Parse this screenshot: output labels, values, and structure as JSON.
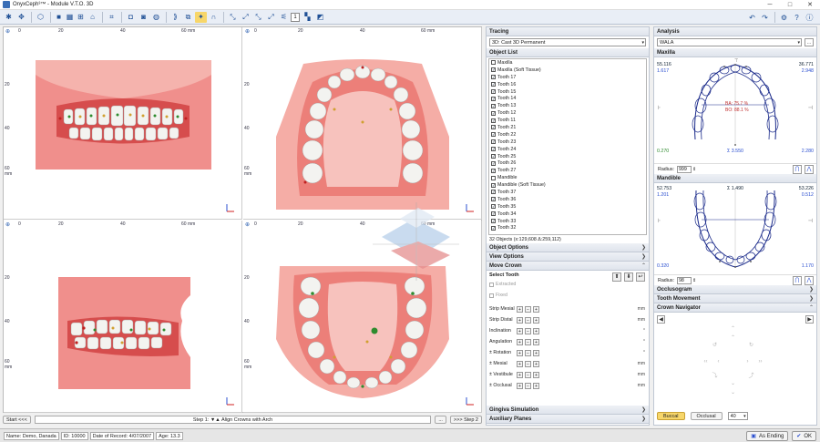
{
  "window": {
    "title": "OnyxCeph³™ - Module V.T.O. 3D"
  },
  "toolbar": {
    "spin_value": "1"
  },
  "viewports": {
    "rulers_h": [
      "0",
      "20",
      "40",
      "60 mm"
    ],
    "rulers_v": [
      "20",
      "40",
      "60 mm"
    ]
  },
  "step": {
    "start": "Start <<<",
    "text": "Step  1: ▼▲ Align Crowns with Arch",
    "ellipsis": "...",
    "next": ">>> Step 2"
  },
  "patient": {
    "name": "Name: Demo, Danada",
    "id": "ID: 10000",
    "date": "Date of Record: 4/07/2007",
    "age": "Age: 13.3"
  },
  "footer": {
    "as_ending": "As Ending",
    "ok": "OK"
  },
  "tracing": {
    "title": "Tracing",
    "selected": "3D: Cast 3D Permanent"
  },
  "object_list": {
    "title": "Object List",
    "items": [
      {
        "label": "Maxilla",
        "checked": false
      },
      {
        "label": "Maxilla (Soft Tissue)",
        "checked": true
      },
      {
        "label": "Tooth 17",
        "checked": true
      },
      {
        "label": "Tooth 16",
        "checked": true
      },
      {
        "label": "Tooth 15",
        "checked": true
      },
      {
        "label": "Tooth 14",
        "checked": true
      },
      {
        "label": "Tooth 13",
        "checked": true
      },
      {
        "label": "Tooth 12",
        "checked": true
      },
      {
        "label": "Tooth 11",
        "checked": true
      },
      {
        "label": "Tooth 21",
        "checked": true
      },
      {
        "label": "Tooth 22",
        "checked": true
      },
      {
        "label": "Tooth 23",
        "checked": true
      },
      {
        "label": "Tooth 24",
        "checked": true
      },
      {
        "label": "Tooth 25",
        "checked": true
      },
      {
        "label": "Tooth 26",
        "checked": true
      },
      {
        "label": "Tooth 27",
        "checked": true
      },
      {
        "label": "Mandible",
        "checked": false
      },
      {
        "label": "Mandible (Soft Tissue)",
        "checked": true
      },
      {
        "label": "Tooth 37",
        "checked": true
      },
      {
        "label": "Tooth 36",
        "checked": true
      },
      {
        "label": "Tooth 35",
        "checked": true
      },
      {
        "label": "Tooth 34",
        "checked": true
      },
      {
        "label": "Tooth 33",
        "checked": true
      },
      {
        "label": "Tooth 32",
        "checked": true
      }
    ],
    "footer": "32 Objects (x:129,608 Δ:259,112)"
  },
  "sections": {
    "object_options": "Object Options",
    "view_options": "View Options",
    "move_crown": "Move Crown",
    "gingiva_simulation": "Gingiva Simulation",
    "auxiliary_planes": "Auxiliary Planes"
  },
  "move_crown": {
    "select_tooth": "Select Tooth",
    "extracted": "Extracted",
    "fixed": "Fixed",
    "rows": [
      {
        "label": "Strip Mesial",
        "unit": "mm"
      },
      {
        "label": "Strip Distal",
        "unit": "mm"
      },
      {
        "label": "Inclination",
        "unit": "°"
      },
      {
        "label": "Angulation",
        "unit": "°"
      },
      {
        "label": "± Rotation",
        "unit": "°"
      },
      {
        "label": "± Mesial",
        "unit": "mm"
      },
      {
        "label": "± Vestibule",
        "unit": "mm"
      },
      {
        "label": "± Occlusal",
        "unit": "mm"
      }
    ]
  },
  "analysis": {
    "title": "Analysis",
    "selected": "WALA",
    "maxilla": {
      "title": "Maxilla",
      "tl": "55.116",
      "tl2": "1.617",
      "tr": "36.771",
      "tr2": "2.948",
      "ba": "BA: 75.7 %",
      "bo": "BO: 88.1 %",
      "bl": "0.270",
      "bc": "Σ 3.550",
      "br": "2.280",
      "radius_label": "Radius:",
      "radius": "999"
    },
    "mandible": {
      "title": "Mandible",
      "tl": "52.753",
      "tl2": "1.201",
      "tc": "Σ 1.490",
      "tr": "53.226",
      "tr2": "0.512",
      "bl": "0.320",
      "br": "1.170",
      "radius_label": "Radius:",
      "radius": "98"
    }
  },
  "right_sections": {
    "occlusogram": "Occlusogram",
    "tooth_movement": "Tooth Movement",
    "crown_navigator": "Crown Navigator"
  },
  "navigator": {
    "buccal": "Buccal",
    "occlusal": "Occlusal",
    "zoom": "40"
  }
}
